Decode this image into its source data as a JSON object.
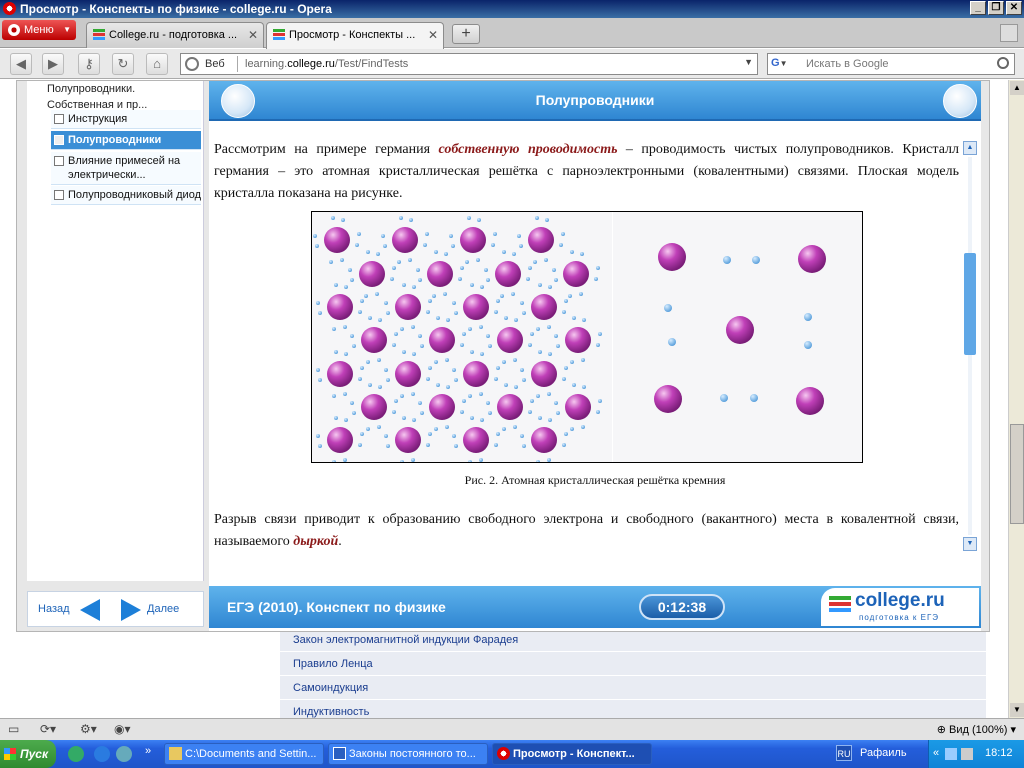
{
  "window": {
    "title": "Просмотр - Конспекты по физике - college.ru - Opera"
  },
  "browser": {
    "menu_label": "Меню",
    "tabs": [
      {
        "label": "College.ru - подготовка ..."
      },
      {
        "label": "Просмотр - Конспекты ..."
      }
    ],
    "address": {
      "prefix": "Веб",
      "url_pre": "learning.",
      "url_host": "college.ru",
      "url_post": "/Test/FindTests"
    },
    "search_placeholder": "Искать в Google",
    "zoom": "Вид (100%)"
  },
  "app": {
    "sidebar": {
      "top_item": "Полупроводники. Собственная и пр...",
      "items": [
        {
          "label": "Инструкция"
        },
        {
          "label": "Полупроводники"
        },
        {
          "label": "Влияние примесей на электрически..."
        },
        {
          "label": "Полупроводниковый диод"
        }
      ],
      "back_label": "Назад",
      "next_label": "Далее"
    },
    "header": {
      "title": "Полупроводники"
    },
    "content": {
      "para1_a": "Рассмотрим на примере германия ",
      "para1_em": "собственную проводимость",
      "para1_b": " – проводимость чистых полупроводников. Кристалл германия – это атомная кристаллическая решётка с парноэлектронными (ковалентными) связями. Плоская модель кристалла показана на рисунке.",
      "caption": "Рис. 2. Атомная кристаллическая решётка кремния",
      "para2_a": "Разрыв связи приводит к образованию свободного электрона и свободного (вакантного) места в ковалентной связи, называемого ",
      "para2_em": "дыркой",
      "para2_b": "."
    },
    "footer": {
      "title": "ЕГЭ (2010). Конспект по физике",
      "timer": "0:12:38",
      "logo": "college.ru",
      "logo_sub": "подготовка к ЕГЭ"
    }
  },
  "background_links": [
    {
      "label": "Закон электромагнитной индукции Фарадея"
    },
    {
      "label": "Правило Ленца"
    },
    {
      "label": "Самоиндукция"
    },
    {
      "label": "Индуктивность"
    }
  ],
  "taskbar": {
    "start": "Пуск",
    "tasks": [
      {
        "label": "C:\\Documents and Settin..."
      },
      {
        "label": "Законы постоянного то..."
      },
      {
        "label": "Просмотр - Конспект..."
      }
    ],
    "lang": "RU",
    "user": "Рафаиль",
    "clock": "18:12"
  },
  "colors": {
    "accent_blue": "#2f86d2",
    "atom": "#c040b8",
    "electron": "#5aa0dc",
    "emphasis": "#8b1a1a"
  }
}
